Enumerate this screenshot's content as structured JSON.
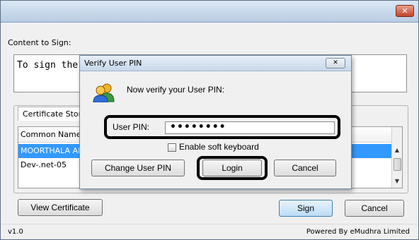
{
  "window": {
    "close_glyph": "✕"
  },
  "main": {
    "content_label": "Content to Sign:",
    "content_text": "To sign the",
    "cert_store_tab": "Certificate Stor",
    "table": {
      "column_header": "Common Name",
      "rows": [
        "MOORTHALA AN",
        "Dev-.net-05",
        ""
      ]
    },
    "view_certificate_button": "View Certificate",
    "sign_button": "Sign",
    "cancel_button": "Cancel"
  },
  "footer": {
    "version": "v1.0",
    "powered_by": "Powered By eMudhra Limited"
  },
  "dialog": {
    "title": "Verify User PIN",
    "close_glyph": "✕",
    "prompt": "Now verify your User PIN:",
    "pin_label": "User PIN:",
    "pin_value": "••••••••",
    "soft_keyboard_label": "Enable soft keyboard",
    "soft_keyboard_checked": false,
    "change_pin_button": "Change User PIN",
    "login_button": "Login",
    "cancel_button": "Cancel"
  },
  "icons": {
    "users": "users-icon",
    "close": "close-icon",
    "scroll_up": "chevron-up-icon",
    "scroll_down": "chevron-down-icon"
  },
  "colors": {
    "selection": "#3399ff",
    "close_button": "#c3452b",
    "highlight": "#000000"
  }
}
